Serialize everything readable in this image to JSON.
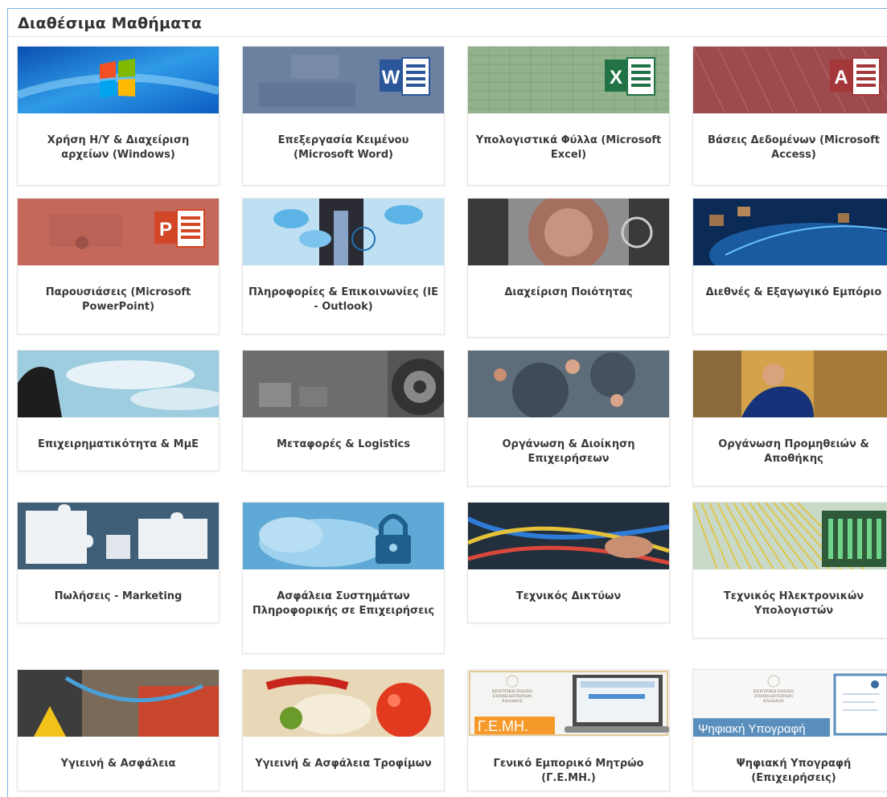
{
  "section": {
    "title": "Διαθέσιμα Μαθήματα"
  },
  "courses": [
    {
      "title": "Χρήση Η/Υ & Διαχείριση αρχείων (Windows)",
      "thumb": "windows-logo"
    },
    {
      "title": "Επεξεργασία Κειμένου (Microsoft Word)",
      "thumb": "word-logo"
    },
    {
      "title": "Υπολογιστικά Φύλλα (Microsoft Excel)",
      "thumb": "excel-logo"
    },
    {
      "title": "Βάσεις Δεδομένων (Microsoft Access)",
      "thumb": "access-logo"
    },
    {
      "title": "Παρουσιάσεις (Microsoft PowerPoint)",
      "thumb": "powerpoint-logo"
    },
    {
      "title": "Πληροφορίες & Επικοινωνίες (IE - Outlook)",
      "thumb": "cloud-network"
    },
    {
      "title": "Διαχείριση Ποιότητας",
      "thumb": "lens-gears"
    },
    {
      "title": "Διεθνές & Εξαγωγικό Εμπόριο",
      "thumb": "world-trade"
    },
    {
      "title": "Επιχειρηματικότητα & ΜμΕ",
      "thumb": "sky-person"
    },
    {
      "title": "Μεταφορές & Logistics",
      "thumb": "warehouse-gears"
    },
    {
      "title": "Οργάνωση & Διοίκηση Επιχειρήσεων",
      "thumb": "people-gears"
    },
    {
      "title": "Οργάνωση Προμηθειών & Αποθήκης",
      "thumb": "warehouse-worker"
    },
    {
      "title": "Πωλήσεις - Marketing",
      "thumb": "puzzle"
    },
    {
      "title": "Ασφάλεια Συστημάτων Πληροφορικής σε Επιχειρήσεις",
      "thumb": "cloud-lock"
    },
    {
      "title": "Τεχνικός Δικτύων",
      "thumb": "network-cables"
    },
    {
      "title": "Τεχνικός Ηλεκτρονικών Υπολογιστών",
      "thumb": "server-wiring"
    },
    {
      "title": "Υγιεινή & Ασφάλεια",
      "thumb": "safety-equipment"
    },
    {
      "title": "Υγιεινή & Ασφάλεια Τροφίμων",
      "thumb": "food"
    },
    {
      "title": "Γενικό Εμπορικό Μητρώο (Γ.Ε.ΜΗ.)",
      "thumb": "gemi-laptop",
      "thumb_text": {
        "logo_lines": [
          "ΚΕΝΤΡΙΚΗ ΕΝΩΣΗ",
          "ΕΠΙΜΕΛΗΤΗΡΙΩΝ",
          "ΕΛΛΑΔΟΣ"
        ],
        "label": "Γ.Ε.ΜΗ."
      }
    },
    {
      "title": "Ψηφιακή Υπογραφή (Επιχειρήσεις)",
      "thumb": "digital-signature",
      "thumb_text": {
        "logo_lines": [
          "ΚΕΝΤΡΙΚΗ ΕΝΩΣΗ",
          "ΕΠΙΜΕΛΗΤΗΡΙΩΝ",
          "ΕΛΛΑΔΟΣ"
        ],
        "label": "Ψηφιακή Υπογραφή"
      }
    }
  ],
  "colors": {
    "heading": "#333333",
    "frame_border": "#7ab1dd",
    "card_border": "#e3e3e3",
    "word": "#2b579a",
    "excel": "#217346",
    "access": "#a4373a",
    "powerpoint": "#d24726"
  }
}
